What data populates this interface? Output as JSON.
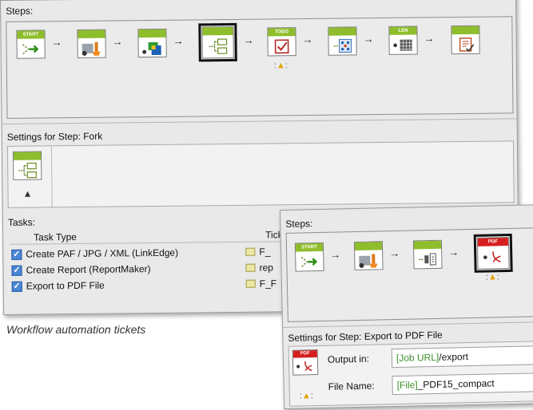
{
  "main": {
    "steps_label": "Steps:",
    "steps": [
      {
        "name": "start",
        "badge": "START"
      },
      {
        "name": "paint",
        "badge": ""
      },
      {
        "name": "compose",
        "badge": ""
      },
      {
        "name": "fork",
        "badge": ""
      },
      {
        "name": "todo",
        "badge": "TODO"
      },
      {
        "name": "grid",
        "badge": ""
      },
      {
        "name": "link",
        "badge": "LEN"
      },
      {
        "name": "report",
        "badge": ""
      }
    ],
    "settings_label": "Settings for Step: Fork",
    "tasks_label": "Tasks:",
    "tasks_header": {
      "type": "Task Type",
      "ticket": "Tick"
    },
    "tasks": [
      {
        "label": "Create PAF / JPG / XML (LinkEdge)",
        "ticket": "F_",
        "checked": true
      },
      {
        "label": "Create Report (ReportMaker)",
        "ticket": "rep",
        "checked": true
      },
      {
        "label": "Export to PDF File",
        "ticket": "F_F",
        "checked": true
      }
    ]
  },
  "caption": "Workflow automation tickets",
  "second": {
    "steps_label": "Steps:",
    "steps": [
      {
        "name": "start",
        "badge": "START"
      },
      {
        "name": "paint",
        "badge": ""
      },
      {
        "name": "process",
        "badge": ""
      },
      {
        "name": "pdf",
        "badge": "PDF"
      }
    ],
    "settings_label": "Settings for Step: Export to PDF File",
    "output_label": "Output in:",
    "output_token": "[Job URL]",
    "output_rest": "/export",
    "filename_label": "File Name:",
    "filename_token": "[File]",
    "filename_rest": "_PDF15_compact"
  },
  "colors": {
    "step_header_green": "#8fbe2c",
    "step_header_red": "#d51f1f",
    "token_green": "#3c8f2b",
    "checkbox_blue": "#4a86d6"
  },
  "icons": [
    "bell-icon",
    "checkbox-icon",
    "ticket-icon",
    "fork-step-icon",
    "pdf-step-icon"
  ]
}
